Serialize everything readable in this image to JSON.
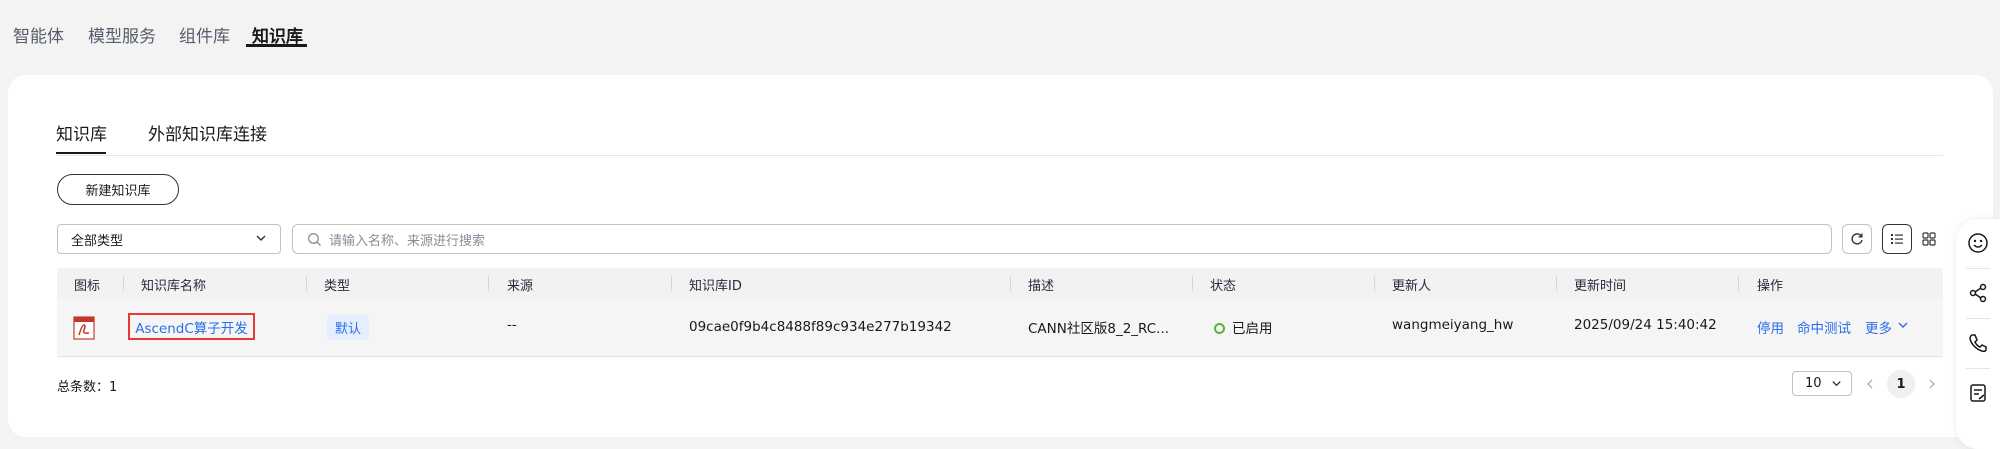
{
  "topnav": {
    "items": [
      "智能体",
      "模型服务",
      "组件库",
      "知识库"
    ],
    "active_index": 3
  },
  "subtabs": {
    "items": [
      "知识库",
      "外部知识库连接"
    ],
    "active_index": 0
  },
  "toolbar": {
    "new_button": "新建知识库",
    "type_select_value": "全部类型",
    "search_placeholder": "请输入名称、来源进行搜索"
  },
  "table": {
    "columns": [
      "图标",
      "知识库名称",
      "类型",
      "来源",
      "知识库ID",
      "描述",
      "状态",
      "更新人",
      "更新时间",
      "操作"
    ],
    "rows": [
      {
        "icon": "pdf-file-icon",
        "name": "AscendC算子开发",
        "type": "默认",
        "source": "--",
        "id": "09cae0f9b4c8488f89c934e277b19342",
        "description": "CANN社区版8_2_RC...",
        "status": "已启用",
        "updater": "wangmeiyang_hw",
        "updated_at": "2025/09/24 15:40:42",
        "actions": [
          "停用",
          "命中测试",
          "更多"
        ]
      }
    ]
  },
  "pagination": {
    "total_label": "总条数：1",
    "page_size": "10",
    "current_page": "1"
  },
  "colors": {
    "link": "#2b6ee8",
    "status_enabled": "#5ab330",
    "highlight_border": "#e53935"
  }
}
